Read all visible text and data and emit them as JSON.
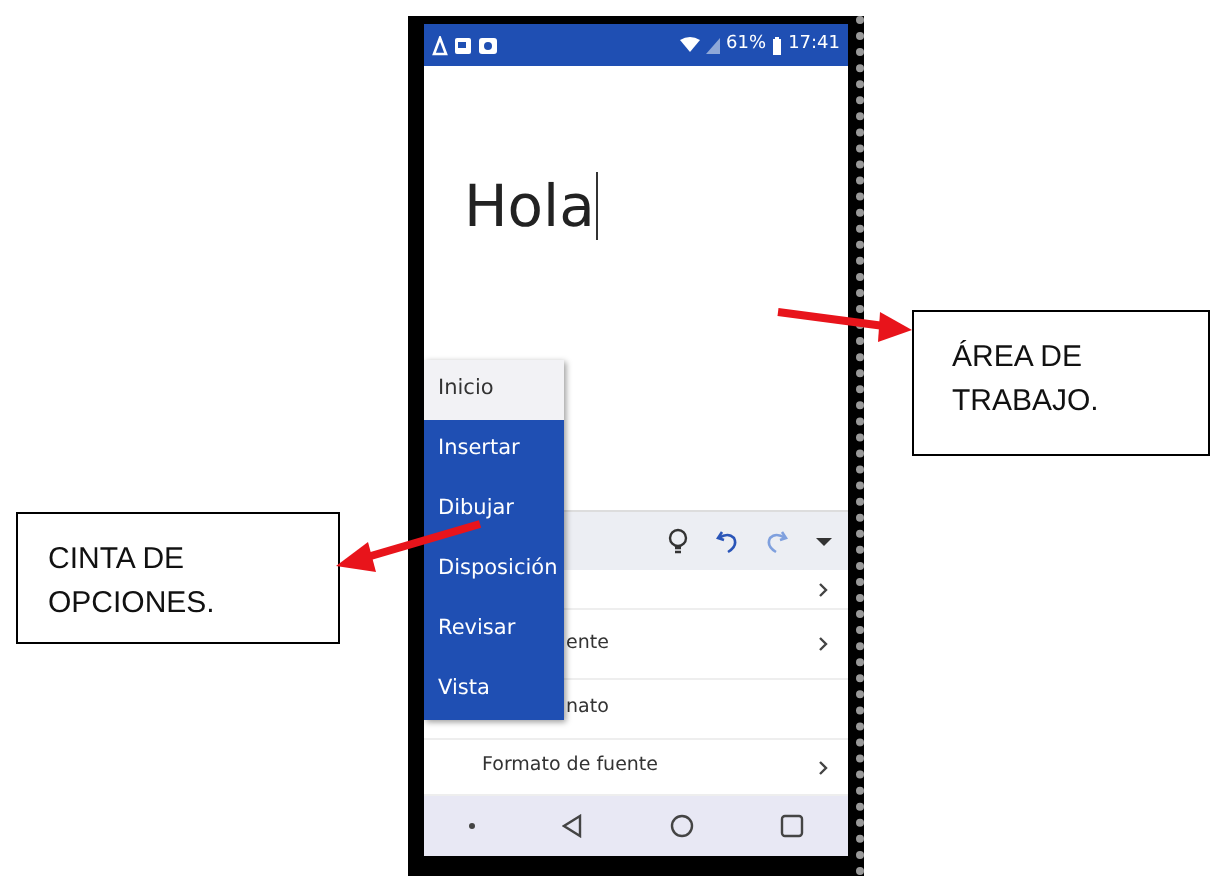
{
  "status_bar": {
    "battery": "61%",
    "time": "17:41"
  },
  "document": {
    "text": "Hola"
  },
  "ribbon_menu": {
    "items": [
      {
        "label": "Inicio",
        "selected": true
      },
      {
        "label": "Insertar",
        "selected": false
      },
      {
        "label": "Dibujar",
        "selected": false
      },
      {
        "label": "Disposición",
        "selected": false
      },
      {
        "label": "Revisar",
        "selected": false
      },
      {
        "label": "Vista",
        "selected": false
      }
    ]
  },
  "option_rows": [
    {
      "kind": "covered"
    },
    {
      "kind": "text",
      "label": "ente"
    },
    {
      "kind": "plain",
      "label": "nato"
    },
    {
      "kind": "text",
      "label": "Formato de fuente"
    }
  ],
  "annotations": [
    {
      "kind": "left",
      "text": "CINTA DE OPCIONES."
    },
    {
      "kind": "right",
      "text": "ÁREA DE TRABAJO."
    }
  ]
}
